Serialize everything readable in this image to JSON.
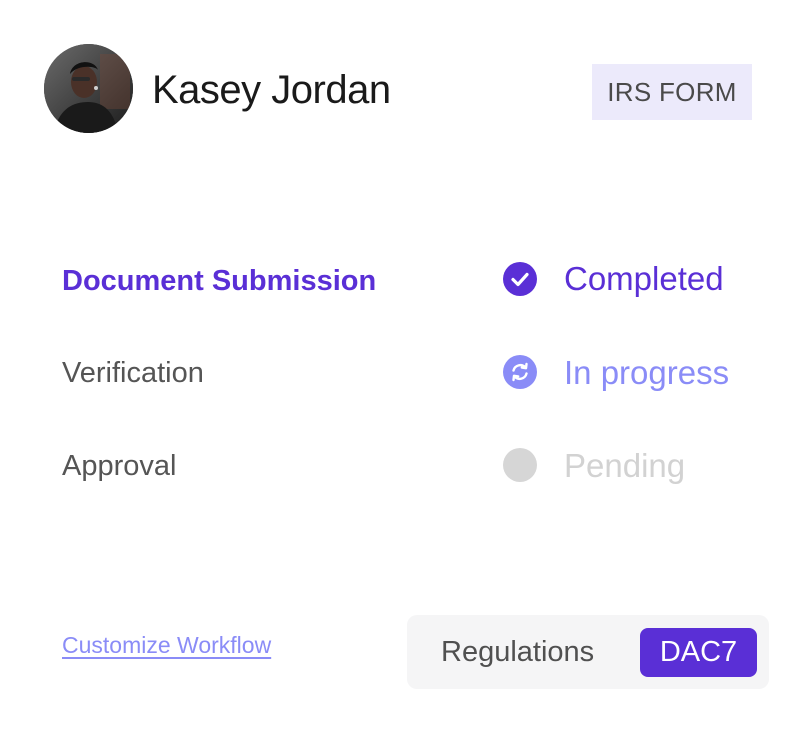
{
  "header": {
    "user_name": "Kasey Jordan",
    "form_badge": "IRS FORM"
  },
  "steps": [
    {
      "label": "Document Submission",
      "status": "Completed",
      "icon": "check-icon"
    },
    {
      "label": "Verification",
      "status": "In progress",
      "icon": "refresh-icon"
    },
    {
      "label": "Approval",
      "status": "Pending",
      "icon": "circle-icon"
    }
  ],
  "footer": {
    "customize_link": "Customize Workflow",
    "regulations_label": "Regulations",
    "regulation_tag": "DAC7"
  },
  "colors": {
    "primary": "#5A2FD6",
    "in_progress": "#8A8CF7",
    "pending": "#D2D2D2",
    "badge_bg": "#ECEAFB",
    "panel_bg": "#F5F5F6"
  }
}
